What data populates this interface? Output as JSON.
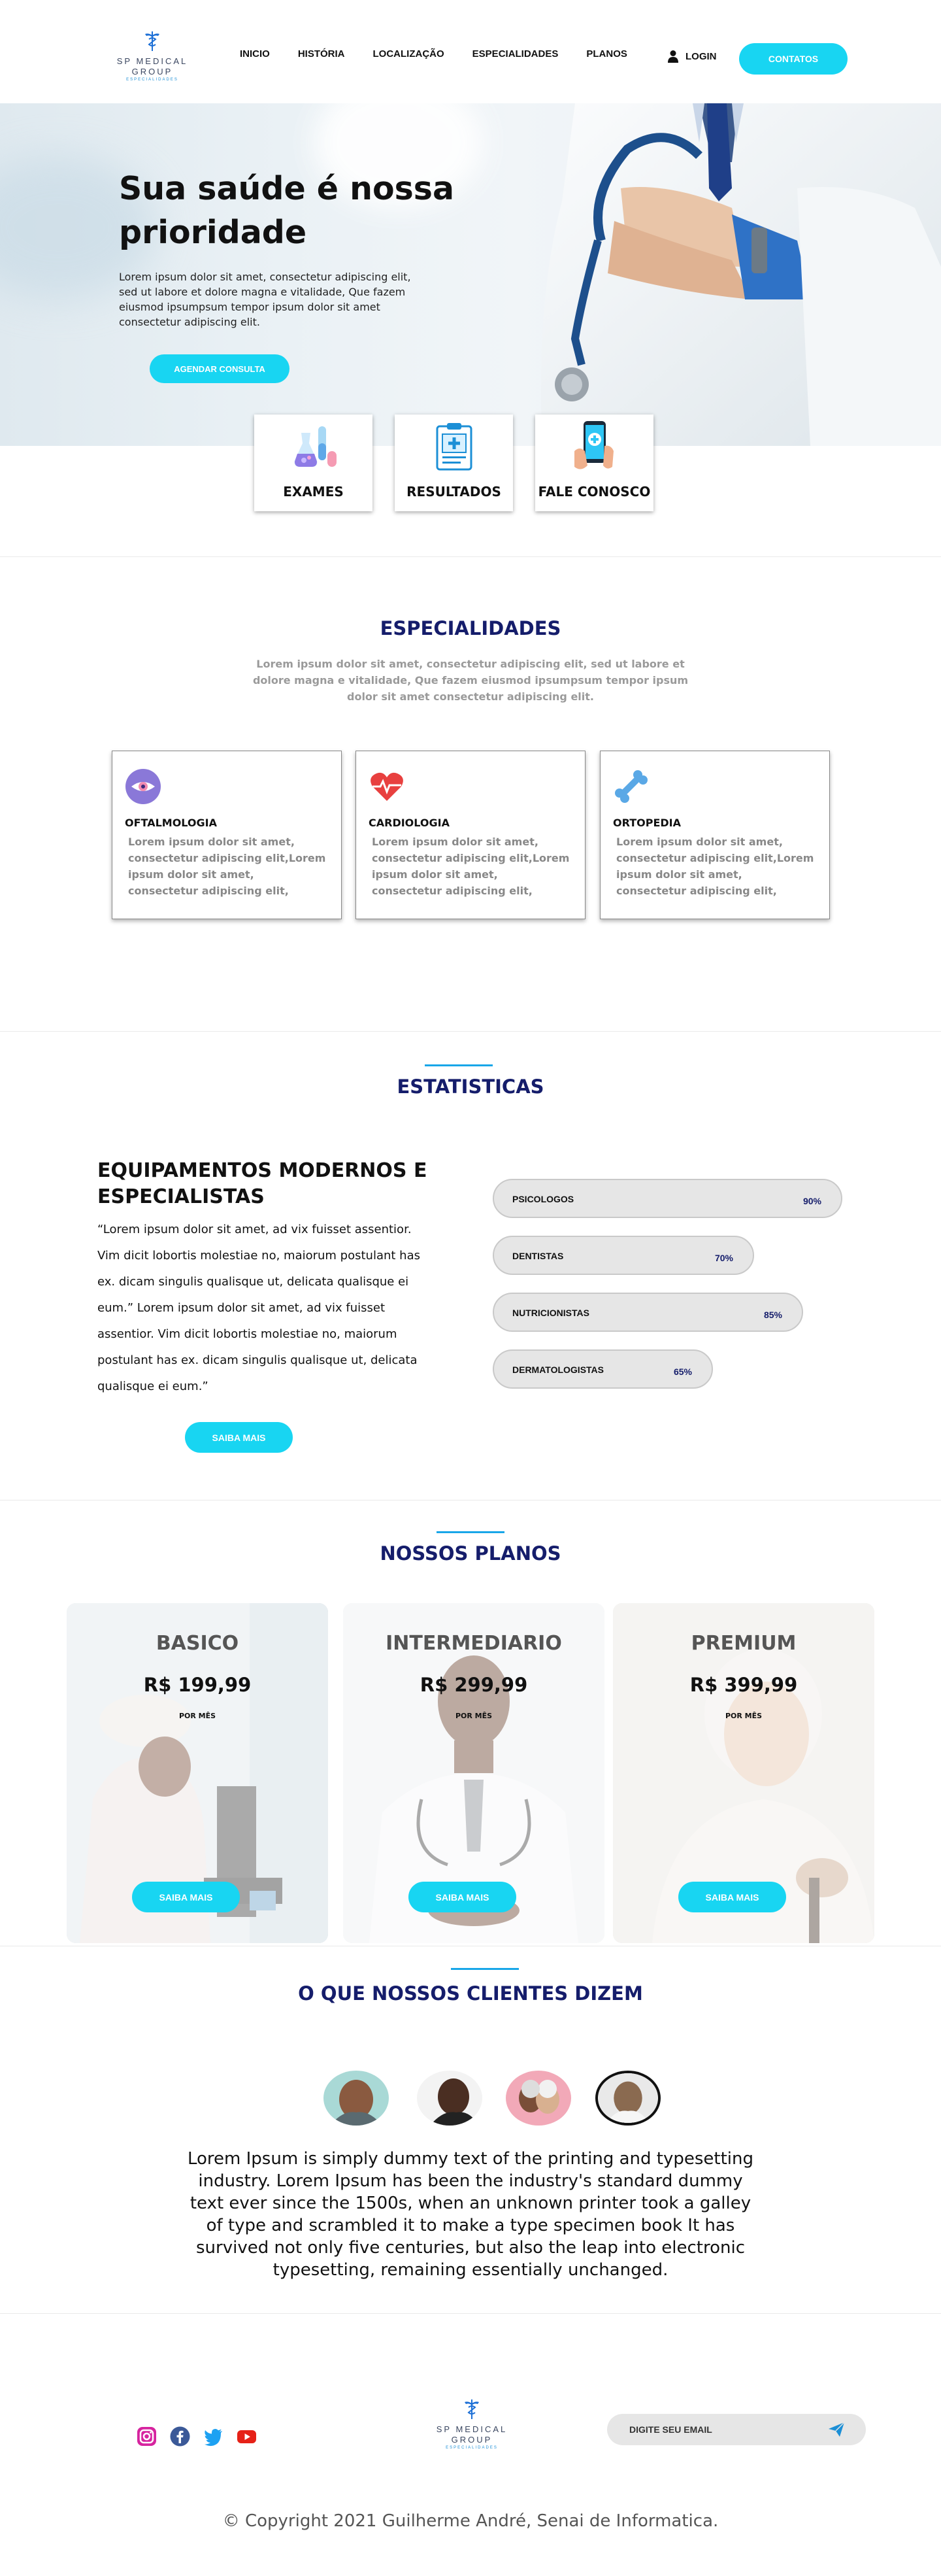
{
  "brand": {
    "line1": "SP MEDICAL",
    "line2": "GROUP",
    "line3": "ESPECIALIDADES"
  },
  "nav": [
    "INICIO",
    "HISTÓRIA",
    "LOCALIZAÇÃO",
    "ESPECIALIDADES",
    "PLANOS"
  ],
  "header": {
    "login": "LOGIN",
    "contact": "CONTATOS"
  },
  "hero": {
    "title": "Sua saúde é nossa prioridade",
    "text": "Lorem ipsum dolor sit amet, consectetur adipiscing elit, sed ut labore et dolore magna e vitalidade, Que fazem eiusmod ipsumpsum tempor ipsum dolor sit amet consectetur adipiscing elit.",
    "cta": "AGENDAR CONSULTA"
  },
  "features": [
    {
      "label": "EXAMES",
      "icon": "lab-flasks-icon"
    },
    {
      "label": "RESULTADOS",
      "icon": "clipboard-icon"
    },
    {
      "label": "FALE CONOSCO",
      "icon": "phone-hand-icon"
    }
  ],
  "specialties": {
    "title": "ESPECIALIDADES",
    "subtitle": "Lorem ipsum dolor sit amet, consectetur adipiscing elit, sed ut labore et dolore magna e vitalidade, Que fazem eiusmod ipsumpsum tempor ipsum dolor sit amet consectetur adipiscing elit.",
    "items": [
      {
        "name": "OFTALMOLOGIA",
        "icon": "eye-icon",
        "text": "Lorem ipsum dolor sit amet, consectetur adipiscing elit,Lorem ipsum dolor sit amet, consectetur adipiscing elit,"
      },
      {
        "name": "CARDIOLOGIA",
        "icon": "heart-pulse-icon",
        "text": "Lorem ipsum dolor sit amet, consectetur adipiscing elit,Lorem ipsum dolor sit amet, consectetur adipiscing elit,"
      },
      {
        "name": "ORTOPEDIA",
        "icon": "bone-icon",
        "text": "Lorem ipsum dolor sit amet, consectetur adipiscing elit,Lorem ipsum dolor sit amet, consectetur adipiscing elit,"
      }
    ]
  },
  "stats": {
    "title": "ESTATISTICAS",
    "heading": "EQUIPAMENTOS MODERNOS E ESPECIALISTAS",
    "text": "“Lorem ipsum dolor sit amet, ad vix fuisset assentior. Vim dicit lobortis molestiae no, maiorum postulant has ex. dicam singulis qualisque ut, delicata qualisque ei eum.” Lorem ipsum dolor sit amet, ad vix fuisset assentior. Vim dicit lobortis molestiae no, maiorum postulant has ex. dicam singulis qualisque ut, delicata qualisque ei eum.”",
    "button": "SAIBA MAIS",
    "bars": [
      {
        "name": "PSICOLOGOS",
        "value": "90%",
        "fraction": 0.9
      },
      {
        "name": "DENTISTAS",
        "value": "70%",
        "fraction": 0.7
      },
      {
        "name": "NUTRICIONISTAS",
        "value": "85%",
        "fraction": 0.85
      },
      {
        "name": "DERMATOLOGISTAS",
        "value": "65%",
        "fraction": 0.65
      }
    ]
  },
  "plans": {
    "title": "NOSSOS PLANOS",
    "items": [
      {
        "name": "BASICO",
        "price": "R$ 199,99",
        "period": "POR MÊS",
        "button": "SAIBA MAIS"
      },
      {
        "name": "INTERMEDIARIO",
        "price": "R$ 299,99",
        "period": "POR MÊS",
        "button": "SAIBA MAIS"
      },
      {
        "name": "PREMIUM",
        "price": "R$ 399,99",
        "period": "POR MÊS",
        "button": "SAIBA MAIS"
      }
    ]
  },
  "testimonials": {
    "title": "O QUE NOSSOS CLIENTES DIZEM",
    "quote": "Lorem Ipsum is simply dummy text of the printing and typesetting industry. Lorem Ipsum has been the industry's standard dummy text ever since the 1500s, when an unknown printer took a galley of type and scrambled it to make a type specimen book It has survived not only five centuries, but also the leap into electronic typesetting, remaining essentially unchanged."
  },
  "footer": {
    "social": [
      "instagram-icon",
      "facebook-icon",
      "twitter-icon",
      "youtube-icon"
    ],
    "email_placeholder": "DIGITE SEU EMAIL",
    "copyright": "© Copyright 2021 Guilherme André, Senai de Informatica."
  },
  "colors": {
    "accent": "#18d5f2",
    "navy": "#151d6b",
    "link_bar": "#18a6e8"
  }
}
